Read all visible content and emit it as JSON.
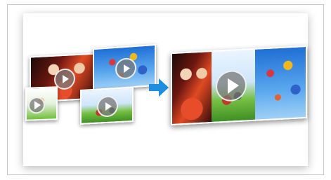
{
  "illustration": {
    "description_icons": [
      "play-icon",
      "arrow-right-icon"
    ],
    "colors": {
      "arrow": "#1e8fe0",
      "frame_border": "#c9c9c9",
      "play_overlay": "#787878"
    }
  }
}
